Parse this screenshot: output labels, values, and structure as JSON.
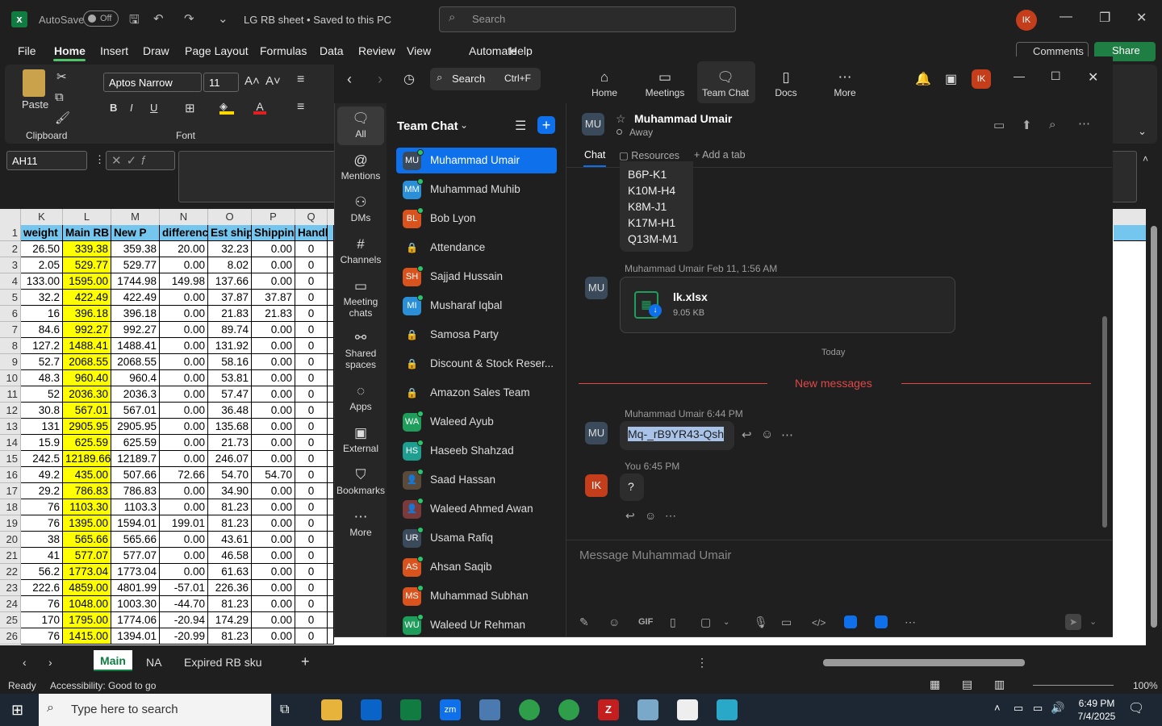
{
  "excel": {
    "title_bar": {
      "autosave": "AutoSave",
      "autosave_state": "Off",
      "doc_title": "LG RB sheet • Saved to this PC",
      "search_placeholder": "Search",
      "user_initials": "IK"
    },
    "menu": [
      "File",
      "Home",
      "Insert",
      "Draw",
      "Page Layout",
      "Formulas",
      "Data",
      "Review",
      "View",
      "Automate",
      "Help"
    ],
    "comments": "Comments",
    "share": "Share",
    "ribbon": {
      "paste": "Paste",
      "clipboard": "Clipboard",
      "font_group": "Font",
      "font_name": "Aptos Narrow",
      "font_size": "11"
    },
    "name_box": "AH11",
    "columns": [
      "K",
      "L",
      "M",
      "N",
      "O",
      "P",
      "Q"
    ],
    "header_row": [
      "weight",
      "Main RB P",
      "New P",
      "differenc",
      "Est ship",
      "Shipping",
      "Handl"
    ],
    "rows": [
      [
        "2",
        "26.50",
        "339.38",
        "359.38",
        "20.00",
        "32.23",
        "0.00",
        "0"
      ],
      [
        "3",
        "2.05",
        "529.77",
        "529.77",
        "0.00",
        "8.02",
        "0.00",
        "0"
      ],
      [
        "4",
        "133.00",
        "1595.00",
        "1744.98",
        "149.98",
        "137.66",
        "0.00",
        "0"
      ],
      [
        "5",
        "32.2",
        "422.49",
        "422.49",
        "0.00",
        "37.87",
        "37.87",
        "0"
      ],
      [
        "6",
        "16",
        "396.18",
        "396.18",
        "0.00",
        "21.83",
        "21.83",
        "0"
      ],
      [
        "7",
        "84.6",
        "992.27",
        "992.27",
        "0.00",
        "89.74",
        "0.00",
        "0"
      ],
      [
        "8",
        "127.2",
        "1488.41",
        "1488.41",
        "0.00",
        "131.92",
        "0.00",
        "0"
      ],
      [
        "9",
        "52.7",
        "2068.55",
        "2068.55",
        "0.00",
        "58.16",
        "0.00",
        "0"
      ],
      [
        "10",
        "48.3",
        "960.40",
        "960.4",
        "0.00",
        "53.81",
        "0.00",
        "0"
      ],
      [
        "11",
        "52",
        "2036.30",
        "2036.3",
        "0.00",
        "57.47",
        "0.00",
        "0"
      ],
      [
        "12",
        "30.8",
        "567.01",
        "567.01",
        "0.00",
        "36.48",
        "0.00",
        "0"
      ],
      [
        "13",
        "131",
        "2905.95",
        "2905.95",
        "0.00",
        "135.68",
        "0.00",
        "0"
      ],
      [
        "14",
        "15.9",
        "625.59",
        "625.59",
        "0.00",
        "21.73",
        "0.00",
        "0"
      ],
      [
        "15",
        "242.5",
        "12189.66",
        "12189.7",
        "0.00",
        "246.07",
        "0.00",
        "0"
      ],
      [
        "16",
        "49.2",
        "435.00",
        "507.66",
        "72.66",
        "54.70",
        "54.70",
        "0"
      ],
      [
        "17",
        "29.2",
        "786.83",
        "786.83",
        "0.00",
        "34.90",
        "0.00",
        "0"
      ],
      [
        "18",
        "76",
        "1103.30",
        "1103.3",
        "0.00",
        "81.23",
        "0.00",
        "0"
      ],
      [
        "19",
        "76",
        "1395.00",
        "1594.01",
        "199.01",
        "81.23",
        "0.00",
        "0"
      ],
      [
        "20",
        "38",
        "565.66",
        "565.66",
        "0.00",
        "43.61",
        "0.00",
        "0"
      ],
      [
        "21",
        "41",
        "577.07",
        "577.07",
        "0.00",
        "46.58",
        "0.00",
        "0"
      ],
      [
        "22",
        "56.2",
        "1773.04",
        "1773.04",
        "0.00",
        "61.63",
        "0.00",
        "0"
      ],
      [
        "23",
        "222.6",
        "4859.00",
        "4801.99",
        "-57.01",
        "226.36",
        "0.00",
        "0"
      ],
      [
        "24",
        "76",
        "1048.00",
        "1003.30",
        "-44.70",
        "81.23",
        "0.00",
        "0"
      ],
      [
        "25",
        "170",
        "1795.00",
        "1774.06",
        "-20.94",
        "174.29",
        "0.00",
        "0"
      ],
      [
        "26",
        "76",
        "1415.00",
        "1394.01",
        "-20.99",
        "81.23",
        "0.00",
        "0"
      ]
    ],
    "sheet_tabs": [
      "Main",
      "NA",
      "Expired RB sku"
    ],
    "status_ready": "Ready",
    "accessibility": "Accessibility: Good to go",
    "zoom_level": "100%"
  },
  "zoom": {
    "nav": [
      "Home",
      "Meetings",
      "Team Chat",
      "Docs",
      "More"
    ],
    "search": "Search",
    "search_shortcut": "Ctrl+F",
    "user_initials": "IK",
    "sidebar": [
      "All",
      "Mentions",
      "DMs",
      "Channels",
      "Meeting chats",
      "Shared spaces",
      "Apps",
      "External",
      "Bookmarks",
      "More"
    ],
    "list_title": "Team Chat",
    "contacts": [
      {
        "name": "Muhammad Umair",
        "av": "MU",
        "color": "#3b4a5b"
      },
      {
        "name": "Muhammad Muhib",
        "av": "MM",
        "color": "#2a8fd6"
      },
      {
        "name": "Bob Lyon",
        "av": "BL",
        "color": "#d9531e"
      },
      {
        "name": "Attendance",
        "av": "🔒",
        "color": "#444"
      },
      {
        "name": "Sajjad Hussain",
        "av": "SH",
        "color": "#d9531e"
      },
      {
        "name": "Musharaf Iqbal",
        "av": "MI",
        "color": "#2a8fd6"
      },
      {
        "name": "Samosa Party",
        "av": "🔒",
        "color": "#444"
      },
      {
        "name": "Discount & Stock Reser...",
        "av": "🔒",
        "color": "#444"
      },
      {
        "name": "Amazon Sales Team",
        "av": "🔒",
        "color": "#444"
      },
      {
        "name": "Waleed Ayub",
        "av": "WA",
        "color": "#1e9e5a"
      },
      {
        "name": "Haseeb Shahzad",
        "av": "HS",
        "color": "#1e9e8f"
      },
      {
        "name": "Saad Hassan",
        "av": "👤",
        "color": "#5a4a3a"
      },
      {
        "name": "Waleed Ahmed Awan",
        "av": "👤",
        "color": "#7a3a3a"
      },
      {
        "name": "Usama Rafiq",
        "av": "UR",
        "color": "#3b4a5b"
      },
      {
        "name": "Ahsan Saqib",
        "av": "AS",
        "color": "#d9531e"
      },
      {
        "name": "Muhammad Subhan",
        "av": "MS",
        "color": "#d9531e"
      },
      {
        "name": "Waleed Ur Rehman",
        "av": "WU",
        "color": "#1e9e5a"
      }
    ],
    "chat": {
      "contact_name": "Muhammad Umair",
      "contact_status": "Away",
      "contact_av": "MU",
      "tabs": [
        "Chat",
        "Resources",
        "Add a tab"
      ],
      "prev_lines": [
        "B6P-K1",
        "K10M-H4",
        "K8M-J1",
        "K17M-H1",
        "Q13M-M1"
      ],
      "file_sender": "Muhammad Umair Feb 11, 1:56 AM",
      "file_name": "lk.xlsx",
      "file_size": "9.05 KB",
      "today": "Today",
      "new_messages": "New messages",
      "msg1_meta": "Muhammad Umair 6:44 PM",
      "msg1_text": "Mq-_rB9YR43-Qsh",
      "msg2_meta": "You 6:45 PM",
      "msg2_text": "?",
      "msg2_av": "IK",
      "composer_placeholder": "Message Muhammad Umair"
    }
  },
  "taskbar": {
    "search": "Type here to search",
    "time": "6:49 PM",
    "date": "7/4/2025"
  }
}
